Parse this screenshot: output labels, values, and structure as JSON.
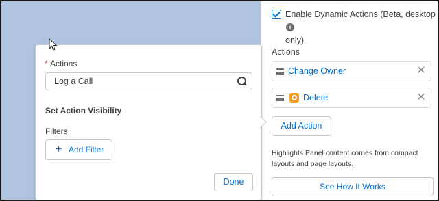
{
  "dynamic_actions": {
    "checked": true,
    "label": "Enable Dynamic Actions (Beta, desktop only)"
  },
  "actions_section": {
    "label": "Actions",
    "items": [
      {
        "label": "Change Owner",
        "icon": "none"
      },
      {
        "label": "Delete",
        "icon": "delete-action-icon"
      }
    ],
    "add_button": "Add Action"
  },
  "help_text": "Highlights Panel content comes from compact layouts and page layouts.",
  "see_how_button": "See How It Works",
  "popover": {
    "required_marker": "*",
    "actions_label": "Actions",
    "actions_value": "Log a Call",
    "visibility_title": "Set Action Visibility",
    "filters_label": "Filters",
    "add_filter_button": "Add Filter",
    "add_filter_icon": "+",
    "done_button": "Done"
  },
  "colors": {
    "accent": "#0070d2",
    "canvas": "#b0c4df",
    "delete_icon": "#f59e21",
    "required": "#c23934"
  }
}
